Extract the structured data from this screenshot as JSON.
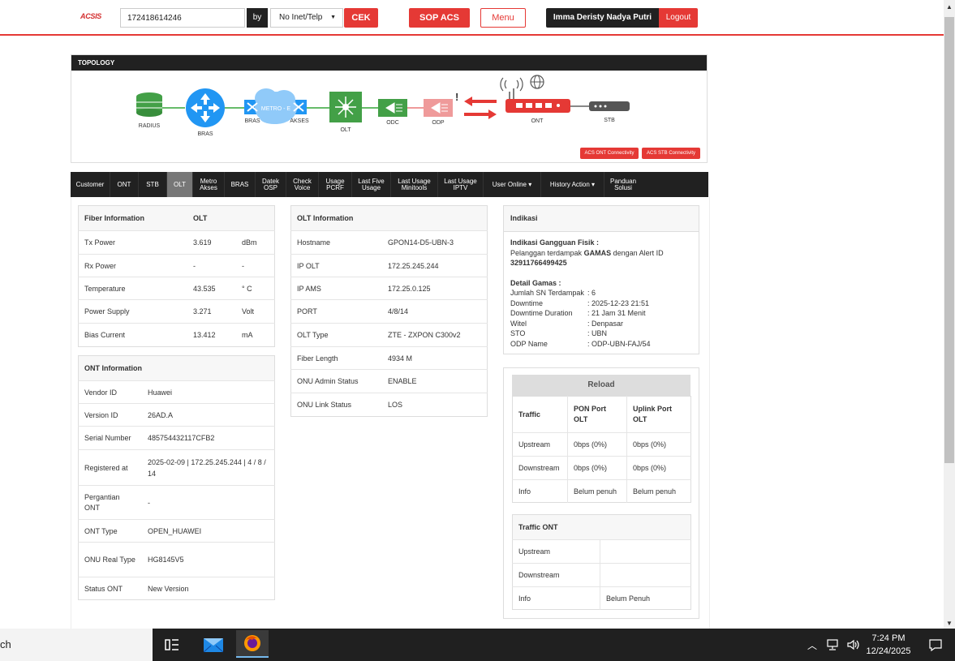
{
  "header": {
    "logo": "ACSIS",
    "search_value": "172418614246",
    "by_label": "by",
    "select_value": "No Inet/Telp",
    "cek_label": "CEK",
    "sop_label": "SOP ACS",
    "menu_label": "Menu",
    "user_name": "Imma Deristy Nadya Putri",
    "logout_label": "Logout"
  },
  "topology": {
    "title": "TOPOLOGY",
    "nodes": [
      "RADIUS",
      "BRAS",
      "BRAS",
      "METRO - E",
      "AKSES",
      "OLT",
      "ODC",
      "ODP",
      "ONT",
      "STB"
    ],
    "acs_ont_button": "ACS ONT Connectivity",
    "acs_stb_button": "ACS STB Connectivity",
    "colors": {
      "radius": "#43a047",
      "bras": "#2196f3",
      "metro": "#90caf9",
      "olt": "#43a047",
      "odc": "#43a047",
      "odp": "#ef9a9a",
      "ont": "#e53935",
      "stb": "#555555",
      "link_ok": "#66bb6a",
      "link_down": "#e53935"
    }
  },
  "tabs": [
    {
      "label": "Customer"
    },
    {
      "label": "ONT"
    },
    {
      "label": "STB"
    },
    {
      "label": "OLT",
      "active": true
    },
    {
      "label": "Metro Akses"
    },
    {
      "label": "BRAS"
    },
    {
      "label": "Datek OSP"
    },
    {
      "label": "Check Voice"
    },
    {
      "label": "Usage PCRF"
    },
    {
      "label": "Last Five Usage"
    },
    {
      "label": "Last Usage Minitools"
    },
    {
      "label": "Last Usage IPTV"
    },
    {
      "label": "User Online ▾"
    },
    {
      "label": "History Action ▾"
    },
    {
      "label": "Panduan Solusi"
    }
  ],
  "fiber": {
    "title": "Fiber Information",
    "col": "OLT",
    "rows": [
      {
        "k": "Tx Power",
        "v": "3.619",
        "u": "dBm"
      },
      {
        "k": "Rx Power",
        "v": "-",
        "u": "-"
      },
      {
        "k": "Temperature",
        "v": "43.535",
        "u": "° C"
      },
      {
        "k": "Power Supply",
        "v": "3.271",
        "u": "Volt"
      },
      {
        "k": "Bias Current",
        "v": "13.412",
        "u": "mA"
      }
    ]
  },
  "ont": {
    "title": "ONT Information",
    "rows": [
      {
        "k": "Vendor ID",
        "v": "Huawei"
      },
      {
        "k": "Version ID",
        "v": "26AD.A"
      },
      {
        "k": "Serial Number",
        "v": "485754432117CFB2"
      },
      {
        "k": "Registered at",
        "v": "2025-02-09 | 172.25.245.244 | 4 / 8 / 14"
      },
      {
        "k": "Pergantian ONT",
        "v": "-"
      },
      {
        "k": "ONT Type",
        "v": "OPEN_HUAWEI"
      },
      {
        "k": "ONU Real Type",
        "v": "HG8145V5"
      },
      {
        "k": "Status ONT",
        "v": "New Version"
      }
    ]
  },
  "olt": {
    "title": "OLT Information",
    "rows": [
      {
        "k": "Hostname",
        "v": "GPON14-D5-UBN-3"
      },
      {
        "k": "IP OLT",
        "v": "172.25.245.244"
      },
      {
        "k": "IP AMS",
        "v": "172.25.0.125"
      },
      {
        "k": "PORT",
        "v": "4/8/14"
      },
      {
        "k": "OLT Type",
        "v": "ZTE - ZXPON C300v2"
      },
      {
        "k": "Fiber Length",
        "v": "4934 M"
      },
      {
        "k": "ONU Admin Status",
        "v": "ENABLE"
      },
      {
        "k": "ONU Link Status",
        "v": "LOS"
      }
    ]
  },
  "indikasi": {
    "title": "Indikasi",
    "gangguan_title": "Indikasi Gangguan Fisik :",
    "gangguan_pre": "Pelanggan terdampak",
    "gangguan_bold": "GAMAS",
    "gangguan_post": "dengan Alert ID",
    "alert_id": "32911766499425",
    "detail_title": "Detail Gamas :",
    "details": [
      {
        "k": "Jumlah SN Terdampak",
        "v": ": 6"
      },
      {
        "k": "Downtime",
        "v": ": 2025-12-23 21:51"
      },
      {
        "k": "Downtime Duration",
        "v": ": 21 Jam 31 Menit"
      },
      {
        "k": "Witel",
        "v": ": Denpasar"
      },
      {
        "k": "STO",
        "v": ": UBN"
      },
      {
        "k": "ODP Name",
        "v": ": ODP-UBN-FAJ/54"
      }
    ]
  },
  "traffic": {
    "reload_label": "Reload",
    "headers": [
      "Traffic",
      "PON Port OLT",
      "Uplink Port OLT"
    ],
    "rows": [
      [
        "Upstream",
        "0bps (0%)",
        "0bps (0%)"
      ],
      [
        "Downstream",
        "0bps (0%)",
        "0bps (0%)"
      ],
      [
        "Info",
        "Belum penuh",
        "Belum penuh"
      ]
    ],
    "ont_title": "Traffic ONT",
    "ont_rows": [
      [
        "Upstream",
        ""
      ],
      [
        "Downstream",
        ""
      ],
      [
        "Info",
        "Belum Penuh"
      ]
    ]
  },
  "taskbar": {
    "search_text": "ch",
    "time": "7:24 PM",
    "date": "12/24/2025"
  }
}
